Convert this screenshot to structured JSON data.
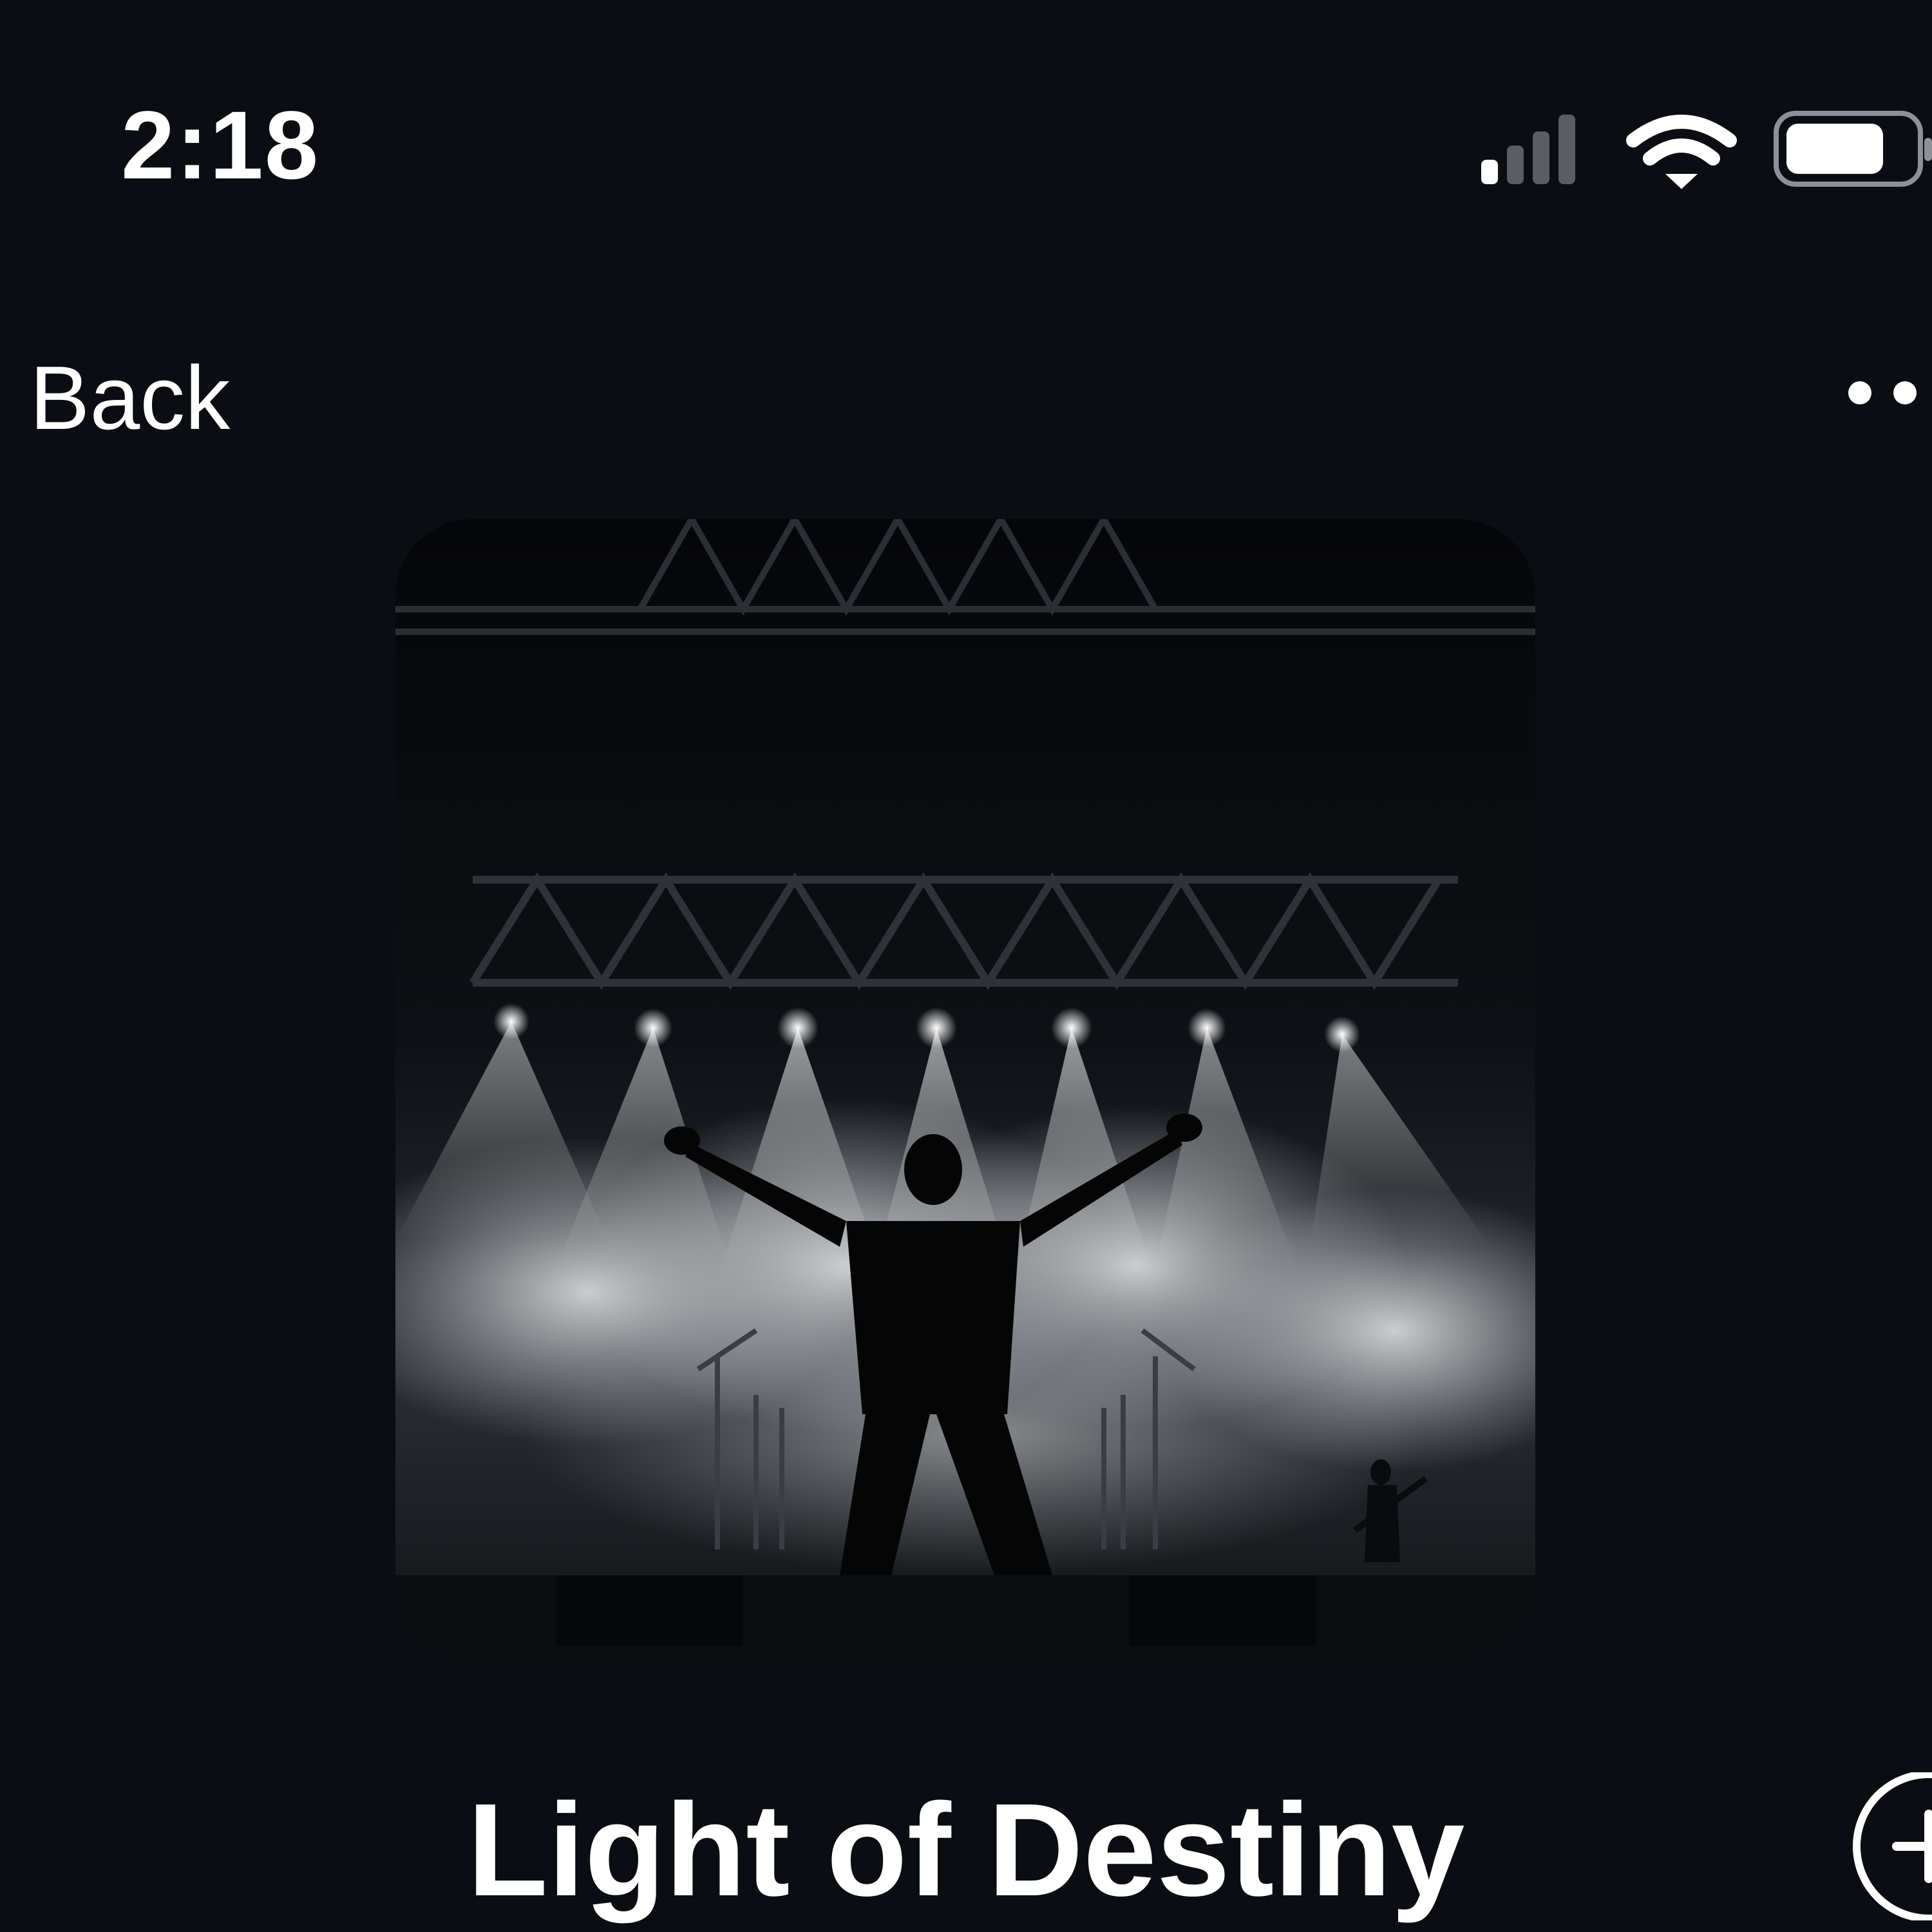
{
  "status_bar": {
    "time": "2:18",
    "icons": [
      "cellular-signal-icon",
      "wifi-icon",
      "battery-icon"
    ]
  },
  "nav": {
    "back_label": "Back",
    "more_icon": "ellipsis-icon"
  },
  "now_playing": {
    "artwork_description_icon": "album-artwork",
    "title": "Light of Destiny",
    "add_icon": "plus-circle-icon"
  },
  "colors": {
    "background": "#0b0d12",
    "text": "#ffffff"
  }
}
